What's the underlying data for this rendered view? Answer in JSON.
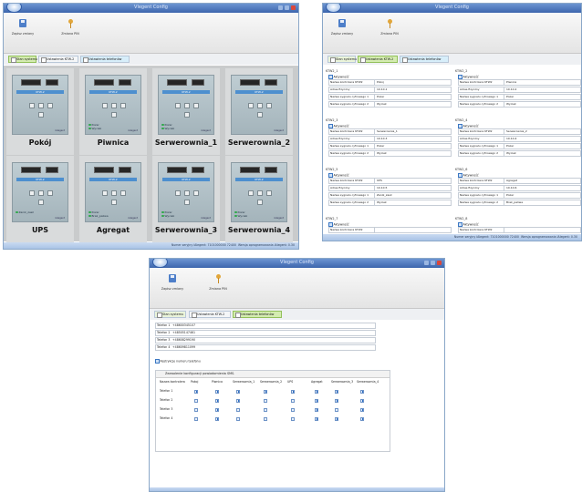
{
  "app": {
    "title": "Vlegent Config",
    "save_label": "Zapisz zmiany",
    "pin_label": "Zmiana PIN"
  },
  "tabs": {
    "system": "Stan systemu",
    "ktw": "Ustawienia KTW-2",
    "phones": "Ustawienia telefonów"
  },
  "status": {
    "serial": "Numer seryjny iAlegent: 7101000000 72400",
    "version": "Wersja oprogramowania iAlegent: 0.30"
  },
  "system": {
    "tiles": [
      {
        "name": "Pokój",
        "header": "KTW-2",
        "inputs": []
      },
      {
        "name": "Piwnica",
        "header": "KTW-2",
        "inputs": [
          "Pozar",
          "Wyciek"
        ]
      },
      {
        "name": "Serwerownia_1",
        "header": "KTW-2",
        "inputs": [
          "Pozar",
          "Wyciek"
        ]
      },
      {
        "name": "Serwerownia_2",
        "header": "KTW-2",
        "inputs": []
      },
      {
        "name": "UPS",
        "header": "KTW-2",
        "inputs": [
          "Zanik_zasil"
        ]
      },
      {
        "name": "Agregat",
        "header": "KTW-2",
        "inputs": [
          "Pozar",
          "Brak_paliwa"
        ]
      },
      {
        "name": "Serwerownia_3",
        "header": "KTW-2",
        "inputs": [
          "Pozar",
          "Wyciek"
        ]
      },
      {
        "name": "Serwerownia_4",
        "header": "KTW-2",
        "inputs": [
          "Pozar",
          "Wyciek"
        ]
      }
    ],
    "brand": "iAlegent"
  },
  "ktw": {
    "labels": {
      "active": "Aktywność",
      "name": "Nazwa kontrolera KTW2",
      "address": "Adres fizyczny",
      "in1": "Nazwa sygnału cyfrowego 1",
      "in2": "Nazwa sygnału cyfrowego 2"
    },
    "groups": [
      {
        "title": "KTW2_1",
        "name": "Pokoj",
        "address": "10.10.1",
        "in1": "Pozar",
        "in2": "Wyciek"
      },
      {
        "title": "KTW2_2",
        "name": "Piwnica",
        "address": "10.10.2",
        "in1": "Pozar",
        "in2": "Wyciek"
      },
      {
        "title": "KTW2_3",
        "name": "Serwerownia_1",
        "address": "10.10.3",
        "in1": "Pozar",
        "in2": "Wyciek"
      },
      {
        "title": "KTW2_4",
        "name": "Serwerownia_2",
        "address": "10.10.4",
        "in1": "Pozar",
        "in2": "Wyciek"
      },
      {
        "title": "KTW2_5",
        "name": "UPS",
        "address": "10.10.5",
        "in1": "Zanik_zasil",
        "in2": "Wyciek"
      },
      {
        "title": "KTW2_6",
        "name": "Agregat",
        "address": "10.10.6",
        "in1": "Pozar",
        "in2": "Brak_paliwa"
      },
      {
        "title": "KTW2_7",
        "name": "",
        "address": "",
        "in1": "",
        "in2": ""
      },
      {
        "title": "KTW2_8",
        "name": "",
        "address": "",
        "in1": "",
        "in2": ""
      }
    ]
  },
  "phones": {
    "list": [
      {
        "label": "Telefon 1",
        "value": "+48600345107"
      },
      {
        "label": "Telefon 2",
        "value": "+48505147461"
      },
      {
        "label": "Telefon 3",
        "value": "+48608299190"
      },
      {
        "label": "Telefon 4",
        "value": "+48609811099"
      }
    ],
    "restrict_label": "Restrykcje numeru telefonu",
    "config_title": "Zezwolenie konfiguracji powiadomienia SMS.",
    "corner_header": "Nazwa kontrolera",
    "columns": [
      "Pokoj",
      "Piwnica",
      "Serwerownia_1",
      "Serwerownia_2",
      "UPS",
      "Agregat",
      "Serwerownia_3",
      "Serwerownia_4"
    ],
    "rows": [
      {
        "label": "Telefon 1",
        "checks": [
          true,
          true,
          true,
          true,
          true,
          true,
          true,
          true
        ]
      },
      {
        "label": "Telefon 2",
        "checks": [
          false,
          true,
          true,
          false,
          false,
          true,
          true,
          true
        ]
      },
      {
        "label": "Telefon 3",
        "checks": [
          false,
          true,
          false,
          false,
          false,
          true,
          false,
          true
        ]
      },
      {
        "label": "Telefon 4",
        "checks": [
          false,
          true,
          false,
          false,
          false,
          true,
          true,
          true
        ]
      }
    ]
  }
}
